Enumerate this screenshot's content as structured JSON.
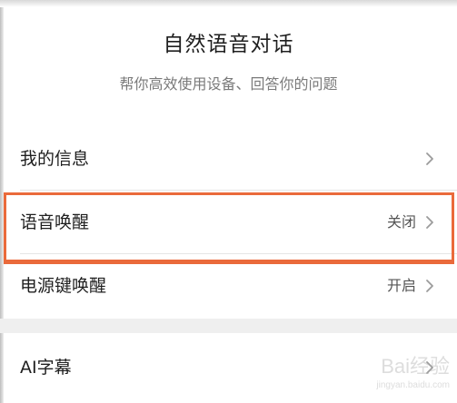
{
  "header": {
    "title": "自然语音对话",
    "subtitle": "帮你高效使用设备、回答你的问题"
  },
  "settings": {
    "items": [
      {
        "label": "我的信息",
        "value": ""
      },
      {
        "label": "语音唤醒",
        "value": "关闭"
      },
      {
        "label": "电源键唤醒",
        "value": "开启"
      },
      {
        "label": "AI字幕",
        "value": ""
      }
    ]
  },
  "watermark": {
    "main": "Bai经验",
    "sub": "jingyan.baidu.com"
  },
  "colors": {
    "highlight": "#ea6a3b",
    "background": "#ffffff",
    "text_primary": "#1f1f1f",
    "text_secondary": "#7a7a7a"
  },
  "icons": {
    "row_chevron": "chevron-right-icon"
  }
}
